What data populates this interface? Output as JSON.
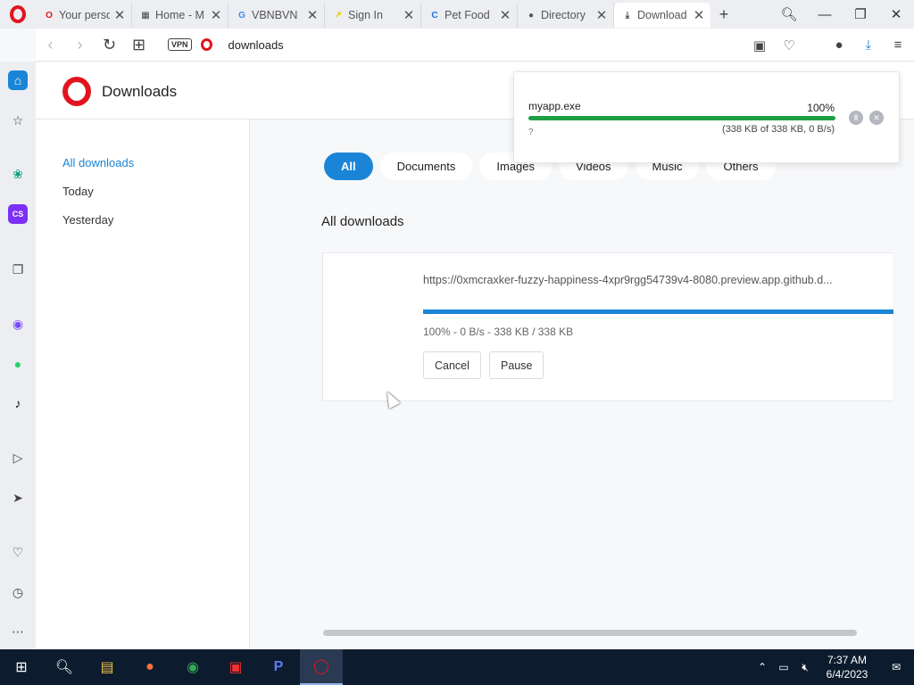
{
  "tabs": [
    {
      "label": "Your perso",
      "fav": "O",
      "color": "#e0151f"
    },
    {
      "label": "Home - M",
      "fav": "▦",
      "color": "#444"
    },
    {
      "label": "VBNBVN",
      "fav": "G",
      "color": "#4285f4"
    },
    {
      "label": "Sign In",
      "fav": "↗",
      "color": "#f5c400"
    },
    {
      "label": "Pet Food",
      "fav": "C",
      "color": "#1a73e8"
    },
    {
      "label": "Directory",
      "fav": "●",
      "color": "#555"
    },
    {
      "label": "Download",
      "fav": "⤓",
      "color": "#444",
      "active": true
    }
  ],
  "address": {
    "vpn": "VPN",
    "url": "downloads"
  },
  "page": {
    "title": "Downloads"
  },
  "nav": {
    "all": "All downloads",
    "today": "Today",
    "yesterday": "Yesterday"
  },
  "filters": [
    "All",
    "Documents",
    "Images",
    "Videos",
    "Music",
    "Others"
  ],
  "section_title": "All downloads",
  "download": {
    "url": "https://0xmcraxker-fuzzy-happiness-4xpr9rgg54739v4-8080.preview.app.github.d...",
    "progress": 1.0,
    "stats": "100% - 0 B/s - 338 KB / 338 KB",
    "cancel_label": "Cancel",
    "pause_label": "Pause"
  },
  "popup": {
    "filename": "myapp.exe",
    "percent": "100%",
    "progress": 1.0,
    "status": "?",
    "size": "(338 KB of 338 KB, 0 B/s)"
  },
  "clock": {
    "time": "7:37 AM",
    "date": "6/4/2023"
  },
  "colors": {
    "accent": "#1a85d6",
    "opera_red": "#e0151f",
    "popup_progress": "#1f9e45"
  }
}
